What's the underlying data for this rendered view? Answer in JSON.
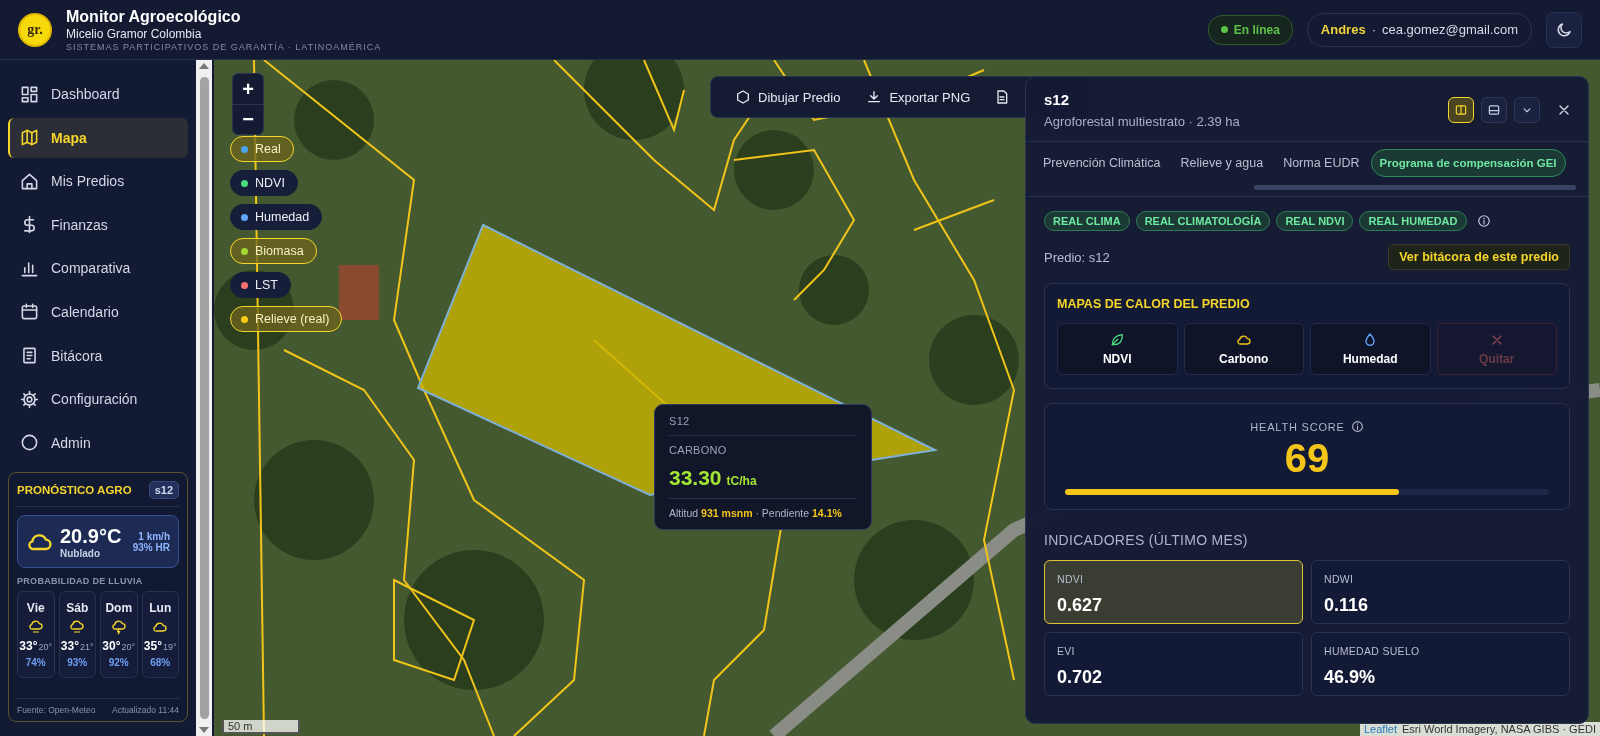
{
  "header": {
    "logo_text": "gr.",
    "title": "Monitor Agroecológico",
    "subtitle": "Micelio Gramor Colombia",
    "tagline": "SISTEMAS PARTICIPATIVOS DE GARANTÍA · LATINOAMÉRICA",
    "status": "En línea",
    "user_name": "Andres",
    "separator": "·",
    "user_email": "cea.gomez@gmail.com"
  },
  "sidebar": {
    "items": [
      {
        "label": "Dashboard",
        "selected": false
      },
      {
        "label": "Mapa",
        "selected": true
      },
      {
        "label": "Mis Predios",
        "selected": false
      },
      {
        "label": "Finanzas",
        "selected": false
      },
      {
        "label": "Comparativa",
        "selected": false
      },
      {
        "label": "Calendario",
        "selected": false
      },
      {
        "label": "Bitácora",
        "selected": false
      },
      {
        "label": "Configuración",
        "selected": false
      },
      {
        "label": "Admin",
        "selected": false
      }
    ]
  },
  "forecast": {
    "title": "PRONÓSTICO AGRO",
    "badge": "s12",
    "temperature": "20.9°C",
    "condition": "Nublado",
    "wind": "1 km/h",
    "humidity": "93% HR",
    "rain_title": "PROBABILIDAD DE LLUVIA",
    "days": [
      {
        "day": "Vie",
        "kind": "rain",
        "high": "33°",
        "low": "20°",
        "rain": "74%"
      },
      {
        "day": "Sáb",
        "kind": "rain",
        "high": "33°",
        "low": "21°",
        "rain": "93%"
      },
      {
        "day": "Dom",
        "kind": "storm",
        "high": "30°",
        "low": "20°",
        "rain": "92%"
      },
      {
        "day": "Lun",
        "kind": "cloud",
        "high": "35°",
        "low": "19°",
        "rain": "68%"
      }
    ],
    "source": "Fuente: Open-Meteo",
    "updated": "Actualizado 11:44"
  },
  "map": {
    "zoom_in": "+",
    "zoom_out": "−",
    "layers": [
      {
        "label": "Real",
        "color": "#4aa3f0",
        "selected": true
      },
      {
        "label": "NDVI",
        "color": "#4ade80",
        "selected": false
      },
      {
        "label": "Humedad",
        "color": "#60a5fa",
        "selected": false
      },
      {
        "label": "Biomasa",
        "color": "#a3d930",
        "selected": true
      },
      {
        "label": "LST",
        "color": "#f87171",
        "selected": false
      },
      {
        "label": "Relieve (real)",
        "color": "#facc15",
        "selected": true
      }
    ],
    "toolbar": [
      {
        "label": "Dibujar Predio",
        "kind": "draw"
      },
      {
        "label": "Exportar PNG",
        "kind": "export"
      }
    ],
    "tooltip": {
      "parcel": "S12",
      "metric": "CARBONO",
      "value": "33.30",
      "unit": "tC/ha",
      "details": "Altitud **931 msnm** · Pendiente **14.1%**"
    },
    "scale": "50 m",
    "attribution_link": "Leaflet",
    "attribution": "Esri World Imagery, NASA GIBS · GEDI"
  },
  "panel": {
    "title": "s12",
    "subtitle": "Agroforestal multiestrato · 2.39 ha",
    "view_buttons": [
      {
        "kind": "split",
        "selected": true
      },
      {
        "kind": "stack",
        "selected": false
      },
      {
        "kind": "collapse",
        "selected": false
      }
    ],
    "tabs": [
      {
        "label": "Prevención Climática",
        "selected": false
      },
      {
        "label": "Relieve y agua",
        "selected": false
      },
      {
        "label": "Norma EUDR",
        "selected": false
      },
      {
        "label": "Programa de compensación GEI",
        "selected": true
      }
    ],
    "chips": [
      "REAL CLIMA",
      "REAL CLIMATOLOGÍA",
      "REAL NDVI",
      "REAL HUMEDAD"
    ],
    "predio": "Predio: s12",
    "log_button": "Ver bitácora de este predio",
    "heatmaps": {
      "title": "MAPAS DE CALOR DEL PREDIO",
      "buttons": [
        {
          "label": "NDVI",
          "kind": "leaf",
          "disabled": false
        },
        {
          "label": "Carbono",
          "kind": "cloud",
          "disabled": false
        },
        {
          "label": "Humedad",
          "kind": "drop",
          "disabled": false
        },
        {
          "label": "Quitar",
          "kind": "remove",
          "disabled": true
        }
      ]
    },
    "health": {
      "label": "HEALTH SCORE",
      "value": "69",
      "level": 0.69
    },
    "indicators_title": "INDICADORES (ÚLTIMO MES)",
    "indicators": [
      {
        "label": "NDVI",
        "value": "0.627",
        "selected": true
      },
      {
        "label": "NDWI",
        "value": "0.116",
        "selected": false
      },
      {
        "label": "EVI",
        "value": "0.702",
        "selected": false
      },
      {
        "label": "HUMEDAD SUELO",
        "value": "46.9%",
        "selected": false
      }
    ]
  }
}
